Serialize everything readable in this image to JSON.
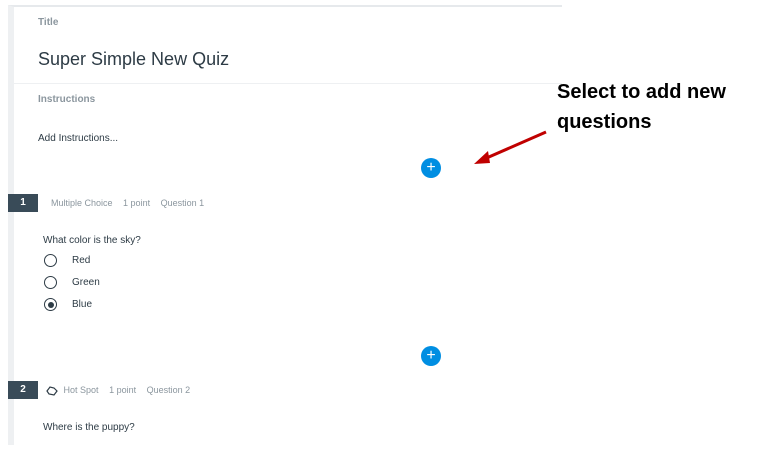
{
  "quiz": {
    "title_label": "Title",
    "title": "Super Simple New Quiz",
    "instructions_label": "Instructions",
    "instructions_placeholder": "Add Instructions..."
  },
  "questions": [
    {
      "number": "1",
      "type": "Multiple Choice",
      "points": "1 point",
      "name": "Question 1",
      "text": "What color is the sky?",
      "options": [
        {
          "label": "Red",
          "selected": false
        },
        {
          "label": "Green",
          "selected": false
        },
        {
          "label": "Blue",
          "selected": true
        }
      ]
    },
    {
      "number": "2",
      "type": "Hot Spot",
      "points": "1 point",
      "name": "Question 2",
      "text": "Where is the puppy?"
    }
  ],
  "add_question_icon": "plus-icon",
  "accent_color": "#008ee2",
  "annotation": {
    "text": "Select to add new questions",
    "color": "#c00000"
  }
}
